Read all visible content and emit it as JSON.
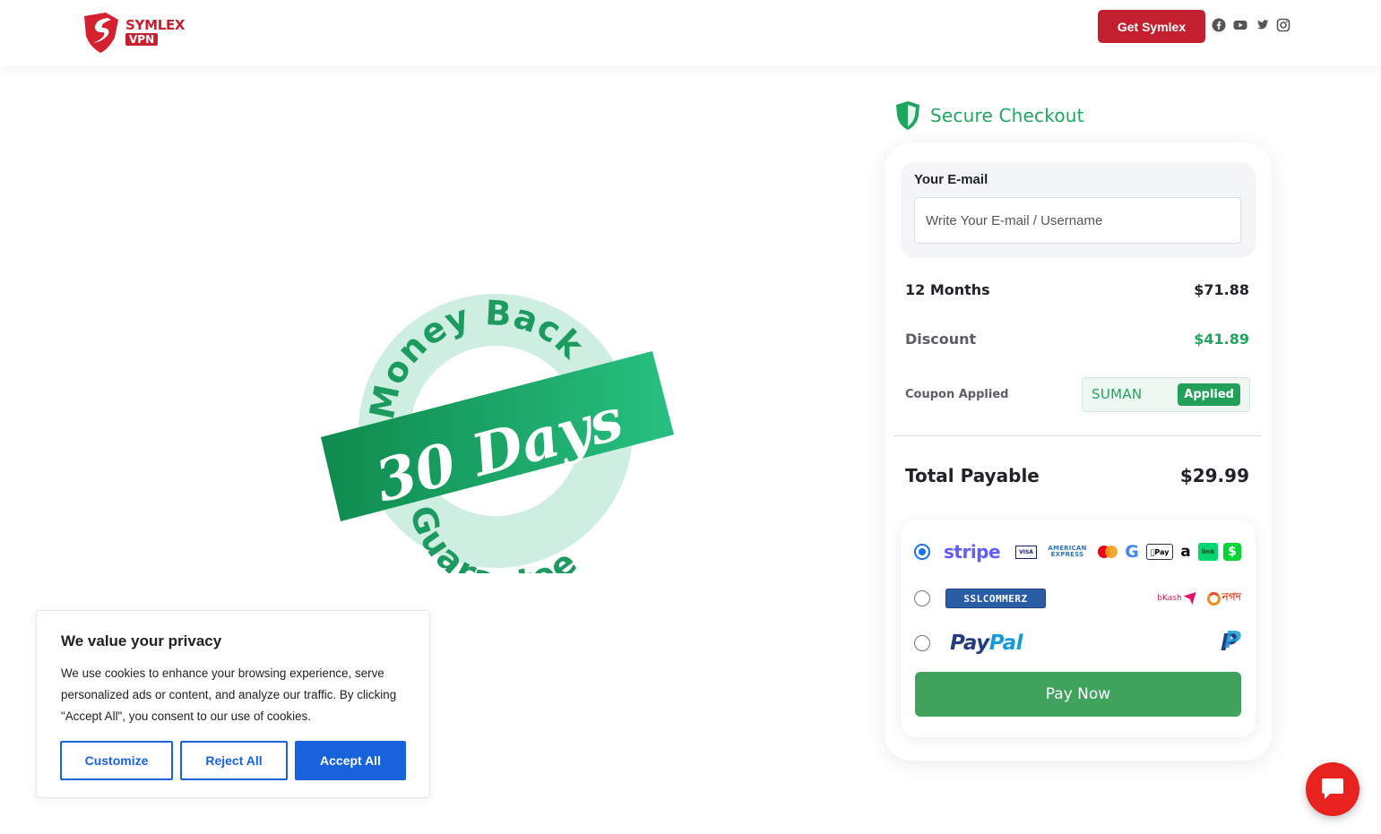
{
  "header": {
    "logo": {
      "top_text": "SYMLEX",
      "bottom_text": "VPN"
    },
    "get_button": "Get Symlex",
    "socials": [
      "facebook-icon",
      "youtube-icon",
      "twitter-icon",
      "instagram-icon"
    ]
  },
  "badge": {
    "arc_top": "Money Back",
    "ribbon": "30 Days",
    "arc_bottom": "Guarantee"
  },
  "checkout": {
    "title": "Secure Checkout",
    "email": {
      "label": "Your E-mail",
      "placeholder": "Write Your E-mail / Username",
      "value": ""
    },
    "plan": {
      "label": "12 Months",
      "price": "$71.88"
    },
    "discount": {
      "label": "Discount",
      "amount": "$41.89"
    },
    "coupon": {
      "label": "Coupon Applied",
      "code": "SUMAN",
      "status": "Applied"
    },
    "total": {
      "label": "Total Payable",
      "amount": "$29.99"
    },
    "payment_methods": [
      {
        "id": "stripe",
        "name": "stripe",
        "selected": true,
        "icons": {
          "visa": "VISA",
          "amex_line1": "AMERICAN",
          "amex_line2": "EXPRESS",
          "google": "G",
          "applepay": "Pay",
          "amazon": "a",
          "link": "link",
          "cashapp": "$"
        }
      },
      {
        "id": "sslcommerz",
        "name": "SSLCOMMERZ",
        "selected": false,
        "icons": {
          "bkash": "bKash",
          "nagad": "নগদ"
        }
      },
      {
        "id": "paypal",
        "name_part1": "Pay",
        "name_part2": "Pal",
        "selected": false,
        "icon": "P"
      }
    ],
    "pay_button": "Pay Now"
  },
  "cookie": {
    "title": "We value your privacy",
    "text": "We use cookies to enhance your browsing experience, serve personalized ads or content, and analyze our traffic. By clicking \"Accept All\", you consent to our use of cookies.",
    "customize": "Customize",
    "reject": "Reject All",
    "accept": "Accept All"
  },
  "colors": {
    "brand_red": "#c41f2f",
    "accent_green": "#1fa65e",
    "pay_button": "#3fa25d",
    "cookie_blue": "#1863dc",
    "chat_red": "#e8231f"
  }
}
